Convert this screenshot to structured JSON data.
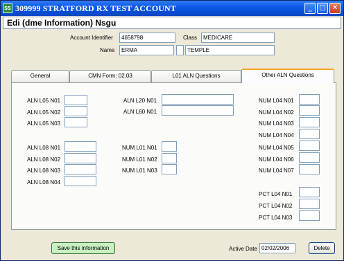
{
  "window": {
    "icon": "SS",
    "title": "309999 STRATFORD RX TEST ACCOUNT",
    "controls": {
      "minimize": "_",
      "maximize": "□",
      "close": "✕"
    }
  },
  "header": {
    "title": "Edi (dme Information) Nsgu"
  },
  "account": {
    "identifier_label": "Account Identifier",
    "identifier_value": "4658798",
    "class_label": "Class",
    "class_value": "MEDICARE",
    "name_label": "Name",
    "first_name": "ERMA",
    "middle_initial": "",
    "last_name": "TEMPLE"
  },
  "tabs": [
    {
      "label": "General",
      "active": false
    },
    {
      "label": "CMN Form: 02.03",
      "active": false
    },
    {
      "label": "L01 ALN Questions",
      "active": false
    },
    {
      "label": "Other ALN Questions",
      "active": true
    }
  ],
  "fields": {
    "aln_l05_n01": {
      "label": "ALN L05 N01",
      "value": ""
    },
    "aln_l05_n02": {
      "label": "ALN L05 N02",
      "value": ""
    },
    "aln_l05_n03": {
      "label": "ALN L05 N03",
      "value": ""
    },
    "aln_l08_n01": {
      "label": "ALN L08 N01",
      "value": ""
    },
    "aln_l08_n02": {
      "label": "ALN L08 N02",
      "value": ""
    },
    "aln_l08_n03": {
      "label": "ALN L08 N03",
      "value": ""
    },
    "aln_l08_n04": {
      "label": "ALN L08 N04",
      "value": ""
    },
    "aln_l20_n01": {
      "label": "ALN L20 N01",
      "value": ""
    },
    "aln_l60_n01": {
      "label": "ALN L60 N01",
      "value": ""
    },
    "num_l01_n01": {
      "label": "NUM L01 N01",
      "value": ""
    },
    "num_l01_n02": {
      "label": "NUM L01 N02",
      "value": ""
    },
    "num_l01_n03": {
      "label": "NUM L01 N03",
      "value": ""
    },
    "num_l04_n01": {
      "label": "NUM L04 N01",
      "value": ""
    },
    "num_l04_n02": {
      "label": "NUM L04 N02",
      "value": ""
    },
    "num_l04_n03": {
      "label": "NUM L04 N03",
      "value": ""
    },
    "num_l04_n04": {
      "label": "NUM L04 N04",
      "value": ""
    },
    "num_l04_n05": {
      "label": "NUM L04 N05",
      "value": ""
    },
    "num_l04_n06": {
      "label": "NUM L04 N06",
      "value": ""
    },
    "num_l04_n07": {
      "label": "NUM L04 N07",
      "value": ""
    },
    "pct_l04_n01": {
      "label": "PCT L04 N01",
      "value": ""
    },
    "pct_l04_n02": {
      "label": "PCT L04 N02",
      "value": ""
    },
    "pct_l04_n03": {
      "label": "PCT L04 N03",
      "value": ""
    }
  },
  "footer": {
    "save_label": "Save this information",
    "active_date_label": "Active Date",
    "active_date_value": "02/02/2006",
    "delete_label": "Delete"
  }
}
